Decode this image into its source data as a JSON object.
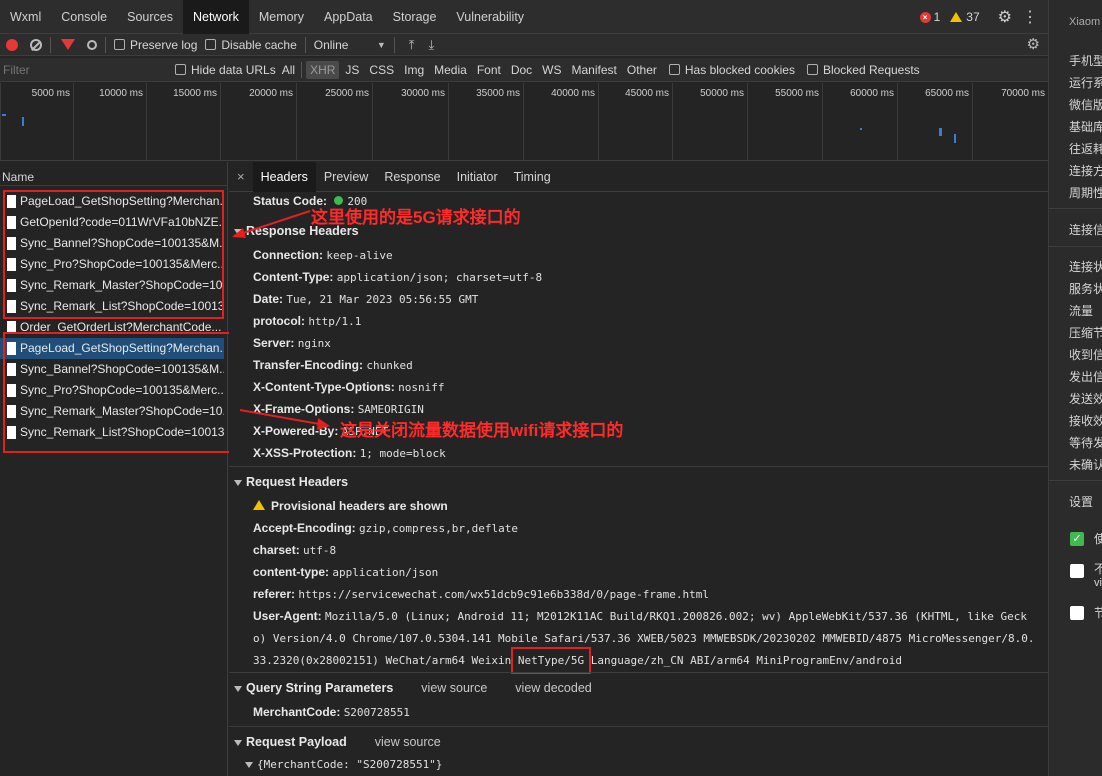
{
  "tabs": [
    "Wxml",
    "Console",
    "Sources",
    "Network",
    "Memory",
    "AppData",
    "Storage",
    "Vulnerability"
  ],
  "active_tab": "Network",
  "counts": {
    "errors": "1",
    "warnings": "37"
  },
  "toolbar": {
    "preserve_log": "Preserve log",
    "disable_cache": "Disable cache",
    "throttle": "Online"
  },
  "filter": {
    "placeholder": "Filter",
    "hide_data_urls": "Hide data URLs",
    "all": "All",
    "types": [
      "XHR",
      "JS",
      "CSS",
      "Img",
      "Media",
      "Font",
      "Doc",
      "WS",
      "Manifest",
      "Other"
    ],
    "has_blocked": "Has blocked cookies",
    "blocked_requests": "Blocked Requests"
  },
  "timeline_ticks": [
    "5000 ms",
    "10000 ms",
    "15000 ms",
    "20000 ms",
    "25000 ms",
    "30000 ms",
    "35000 ms",
    "40000 ms",
    "45000 ms",
    "50000 ms",
    "55000 ms",
    "60000 ms",
    "65000 ms",
    "70000 ms"
  ],
  "requests": {
    "header": "Name",
    "items": [
      "PageLoad_GetShopSetting?Merchan...",
      "GetOpenId?code=011WrVFa10bNZE...",
      "Sync_Bannel?ShopCode=100135&M...",
      "Sync_Pro?ShopCode=100135&Merc...",
      "Sync_Remark_Master?ShopCode=10...",
      "Sync_Remark_List?ShopCode=10013...",
      "Order_GetOrderList?MerchantCode...",
      "PageLoad_GetShopSetting?Merchan...",
      "Sync_Bannel?ShopCode=100135&M...",
      "Sync_Pro?ShopCode=100135&Merc...",
      "Sync_Remark_Master?ShopCode=10...",
      "Sync_Remark_List?ShopCode=10013..."
    ]
  },
  "detail_tabs": [
    "Headers",
    "Preview",
    "Response",
    "Initiator",
    "Timing"
  ],
  "status": {
    "label": "Status Code:",
    "value": "200"
  },
  "response_headers": {
    "title": "Response Headers",
    "items": [
      {
        "k": "Connection:",
        "v": "keep-alive"
      },
      {
        "k": "Content-Type:",
        "v": "application/json; charset=utf-8"
      },
      {
        "k": "Date:",
        "v": "Tue, 21 Mar 2023 05:56:55 GMT"
      },
      {
        "k": "protocol:",
        "v": "http/1.1"
      },
      {
        "k": "Server:",
        "v": "nginx"
      },
      {
        "k": "Transfer-Encoding:",
        "v": "chunked"
      },
      {
        "k": "X-Content-Type-Options:",
        "v": "nosniff"
      },
      {
        "k": "X-Frame-Options:",
        "v": "SAMEORIGIN"
      },
      {
        "k": "X-Powered-By:",
        "v": "ASP.NET"
      },
      {
        "k": "X-XSS-Protection:",
        "v": "1; mode=block"
      }
    ]
  },
  "request_headers": {
    "title": "Request Headers",
    "provisional": "Provisional headers are shown",
    "items": [
      {
        "k": "Accept-Encoding:",
        "v": "gzip,compress,br,deflate"
      },
      {
        "k": "charset:",
        "v": "utf-8"
      },
      {
        "k": "content-type:",
        "v": "application/json"
      },
      {
        "k": "referer:",
        "v": "https://servicewechat.com/wx51dcb9c91e6b338d/0/page-frame.html"
      }
    ],
    "ua_key": "User-Agent:",
    "ua_line1": "Mozilla/5.0 (Linux; Android 11; M2012K11AC Build/RKQ1.200826.002; wv) AppleWebKit/537.36 (KHTML, like Geck",
    "ua_line2": "o) Version/4.0 Chrome/107.0.5304.141 Mobile Safari/537.36 XWEB/5023 MMWEBSDK/20230202 MMWEBID/4875 MicroMessenger/8.0.",
    "ua_line3a": "33.2320(0x28002151) WeChat/arm64 Weixin ",
    "ua_line3b": "NetType/5G",
    "ua_line3c": " Language/zh_CN ABI/arm64 MiniProgramEnv/android"
  },
  "query": {
    "title": "Query String Parameters",
    "view_source": "view source",
    "view_decoded": "view decoded",
    "k": "MerchantCode:",
    "v": "S200728551"
  },
  "payload": {
    "title": "Request Payload",
    "view_source": "view source",
    "v": "{MerchantCode: \"S200728551\"}"
  },
  "annotations": {
    "a1": "这里使用的是5G请求接口的",
    "a2": "这是关闭流量数据使用wifi请求接口的"
  },
  "right_panel": {
    "title": "Xiaom",
    "items": [
      "手机型",
      "运行系",
      "微信版",
      "基础库",
      "往返耗",
      "连接方",
      "周期性"
    ],
    "section1": "连接信",
    "items2": [
      "连接状",
      "服务状",
      "流量",
      "压缩节",
      "收到信",
      "发出信",
      "发送效",
      "接收效",
      "等待发",
      "未确认"
    ],
    "section2": "设置",
    "opts": [
      "使",
      "不",
      "vi",
      "节"
    ]
  },
  "colors": {
    "accent": "#e32020",
    "selected": "#1f4e7a",
    "ok": "#3fb950"
  }
}
